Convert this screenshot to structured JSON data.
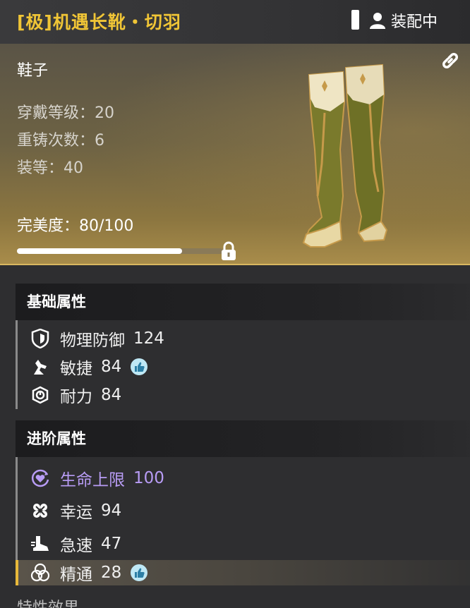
{
  "header": {
    "title": "[极]机遇长靴・切羽",
    "equipped_label": "装配中",
    "title_color": "#f0c536"
  },
  "item": {
    "slot": "鞋子",
    "wear_level": "穿戴等级：20",
    "reforge_count": "重铸次数：6",
    "gear_score": "装等：40",
    "perfection": "完美度：80/100",
    "perfection_value": 0.8,
    "image_icon": "boots-image"
  },
  "basic": {
    "title": "基础属性",
    "rows": [
      {
        "icon": "shield-icon",
        "name": "物理防御",
        "value": "124",
        "thumb": false
      },
      {
        "icon": "agility-icon",
        "name": "敏捷",
        "value": "84",
        "thumb": true
      },
      {
        "icon": "stamina-icon",
        "name": "耐力",
        "value": "84",
        "thumb": false
      }
    ]
  },
  "advanced": {
    "title": "进阶属性",
    "rows": [
      {
        "icon": "heart-circle-icon",
        "name": "生命上限",
        "value": "100",
        "thumb": false,
        "color": "#b89cf5"
      },
      {
        "icon": "clover-icon",
        "name": "幸运",
        "value": "94",
        "thumb": false
      },
      {
        "icon": "boot-speed-icon",
        "name": "急速",
        "value": "47",
        "thumb": false
      },
      {
        "icon": "mastery-icon",
        "name": "精通",
        "value": "28",
        "thumb": true,
        "highlight": true
      }
    ]
  },
  "footer_partial": "特性效果"
}
